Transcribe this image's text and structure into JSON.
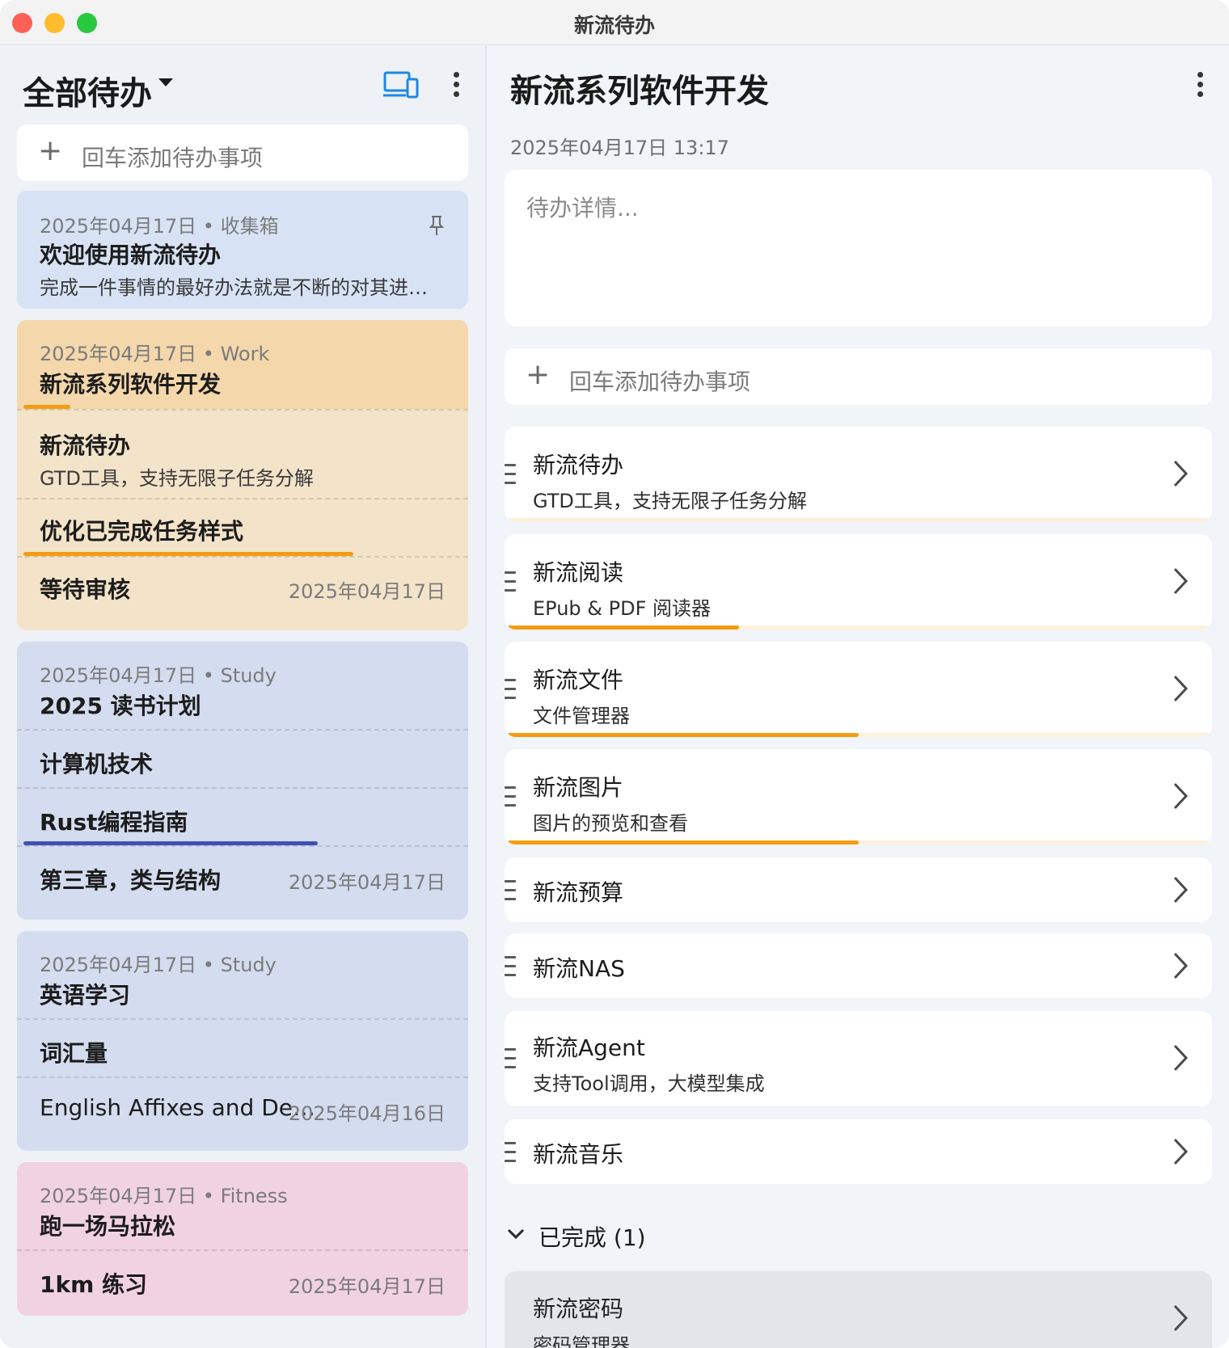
{
  "window": {
    "title": "新流待办"
  },
  "left": {
    "header": {
      "title": "全部待办"
    },
    "add_placeholder": "回车添加待办事项",
    "groups": [
      {
        "color": "#d7e3f5",
        "items": [
          {
            "meta": "2025年04月17日 • 收集箱",
            "title": "欢迎使用新流待办",
            "subtitle": "完成一件事情的最好办法就是不断的对其进…",
            "pinned": true
          }
        ]
      },
      {
        "color": "#f4d7ab",
        "items": [
          {
            "meta": "2025年04月17日 • Work",
            "title": "新流系列软件开发",
            "progress": 0.1,
            "progress_color": "#f39c12"
          },
          {
            "title": "新流待办",
            "subtitle": "GTD工具，支持无限子任务分解",
            "color": "#f3e3c9"
          },
          {
            "title": "优化已完成任务样式",
            "progress": 0.71,
            "progress_color": "#f39c12",
            "color": "#f3e3c9"
          },
          {
            "title": "等待审核",
            "date": "2025年04月17日",
            "color": "#f3e3c9"
          }
        ]
      },
      {
        "color": "#d4dcef",
        "items": [
          {
            "meta": "2025年04月17日 • Study",
            "title": "2025 读书计划"
          },
          {
            "title": "计算机技术"
          },
          {
            "title": "Rust编程指南",
            "progress": 0.63,
            "progress_color": "#3f51b5"
          },
          {
            "title": "第三章，类与结构",
            "date": "2025年04月17日"
          }
        ]
      },
      {
        "color": "#d4dcef",
        "items": [
          {
            "meta": "2025年04月17日 • Study",
            "title": "英语学习"
          },
          {
            "title": "词汇量"
          },
          {
            "title": "English Affixes and De…",
            "date": "2025年04月16日"
          }
        ]
      },
      {
        "color": "#f1d2e3",
        "items": [
          {
            "meta": "2025年04月17日 • Fitness",
            "title": "跑一场马拉松"
          },
          {
            "title": "1km 练习",
            "date": "2025年04月17日"
          }
        ]
      }
    ]
  },
  "right": {
    "title": "新流系列软件开发",
    "date": "2025年04月17日 13:17",
    "details_placeholder": "待办详情...",
    "add_placeholder": "回车添加待办事项",
    "subtasks": [
      {
        "title": "新流待办",
        "subtitle": "GTD工具，支持无限子任务分解",
        "progress": 0.0
      },
      {
        "title": "新流阅读",
        "subtitle": "EPub & PDF 阅读器",
        "progress": 0.33
      },
      {
        "title": "新流文件",
        "subtitle": "文件管理器",
        "progress": 0.5
      },
      {
        "title": "新流图片",
        "subtitle": "图片的预览和查看",
        "progress": 0.5
      },
      {
        "title": "新流预算"
      },
      {
        "title": "新流NAS"
      },
      {
        "title": "新流Agent",
        "subtitle": "支持Tool调用，大模型集成"
      },
      {
        "title": "新流音乐"
      }
    ],
    "completed": {
      "label": "已完成 (1)",
      "items": [
        {
          "title": "新流密码",
          "subtitle": "密码管理器"
        }
      ]
    }
  },
  "icons": {
    "title_dropdown": "caret-down-icon",
    "devices": "devices-icon",
    "more": "more-vertical-icon",
    "add": "plus-icon",
    "pin": "pin-icon",
    "drag": "drag-handle-icon",
    "open": "chevron-right-icon",
    "collapse": "chevron-down-icon"
  },
  "colors": {
    "accent": "#1e88e5",
    "progress_orange": "#f39c12",
    "progress_indigo": "#3f51b5"
  }
}
